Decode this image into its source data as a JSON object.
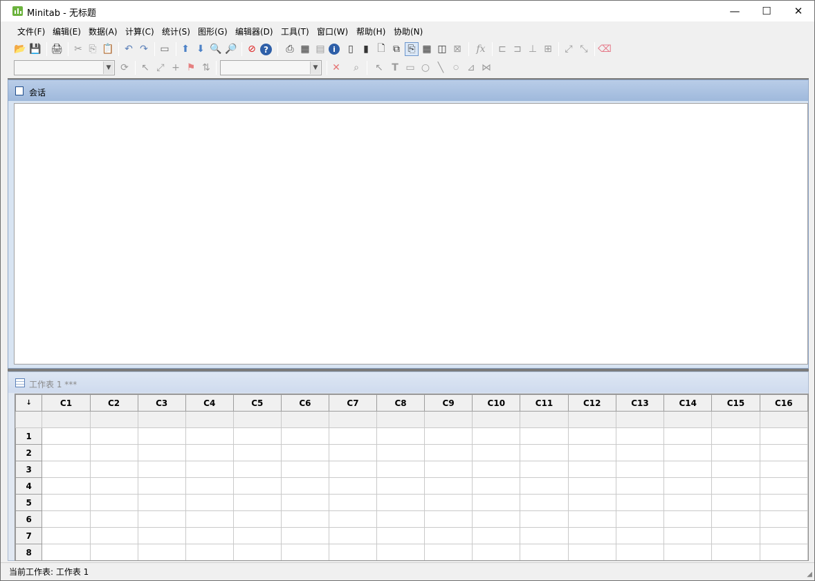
{
  "window": {
    "title": "Minitab - 无标题",
    "minimize": "—",
    "maximize": "☐",
    "close": "✕"
  },
  "menu": [
    "文件(F)",
    "编辑(E)",
    "数据(A)",
    "计算(C)",
    "统计(S)",
    "图形(G)",
    "编辑器(D)",
    "工具(T)",
    "窗口(W)",
    "帮助(H)",
    "协助(N)"
  ],
  "session": {
    "title": "会话"
  },
  "worksheet": {
    "title": "工作表 1 ***",
    "corner": "↓",
    "columns": [
      "C1",
      "C2",
      "C3",
      "C4",
      "C5",
      "C6",
      "C7",
      "C8",
      "C9",
      "C10",
      "C11",
      "C12",
      "C13",
      "C14",
      "C15",
      "C16"
    ],
    "rows": [
      "1",
      "2",
      "3",
      "4",
      "5",
      "6",
      "7",
      "8"
    ]
  },
  "statusbar": {
    "text": "当前工作表: 工作表 1"
  },
  "icons": {
    "open": "📂",
    "save": "💾",
    "print": "🖨",
    "cut": "✂",
    "copy": "⎘",
    "paste": "📋",
    "undo": "↶",
    "redo": "↷",
    "up": "⬆",
    "down": "⬇",
    "stop": "⊘",
    "help": "?",
    "info": "i",
    "fx": "fx",
    "delete": "✕",
    "search": "⌕",
    "text": "T",
    "line": "╲"
  }
}
